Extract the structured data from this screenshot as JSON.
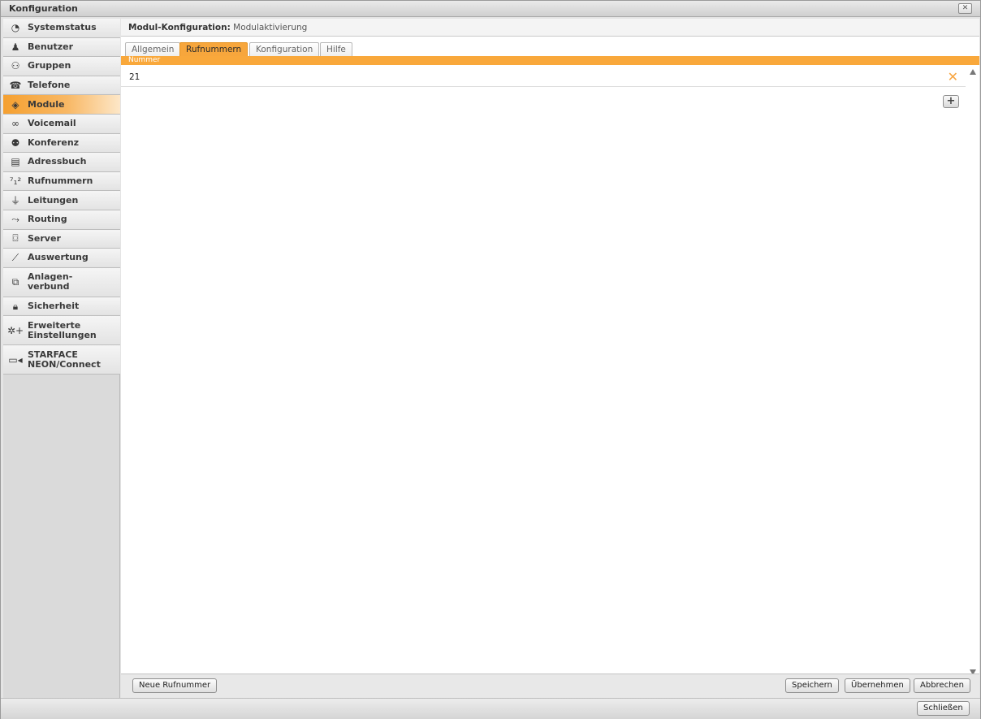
{
  "window": {
    "title": "Konfiguration",
    "close_icon": "close-icon"
  },
  "sidebar": {
    "items": [
      {
        "label": "Systemstatus",
        "icon": "clock-icon"
      },
      {
        "label": "Benutzer",
        "icon": "user-icon"
      },
      {
        "label": "Gruppen",
        "icon": "group-icon"
      },
      {
        "label": "Telefone",
        "icon": "phone-icon"
      },
      {
        "label": "Module",
        "icon": "module-icon",
        "active": true
      },
      {
        "label": "Voicemail",
        "icon": "voicemail-icon"
      },
      {
        "label": "Konferenz",
        "icon": "conference-icon"
      },
      {
        "label": "Adressbuch",
        "icon": "addressbook-icon"
      },
      {
        "label": "Rufnummern",
        "icon": "numbers-icon"
      },
      {
        "label": "Leitungen",
        "icon": "plug-icon"
      },
      {
        "label": "Routing",
        "icon": "routing-icon"
      },
      {
        "label": "Server",
        "icon": "server-icon"
      },
      {
        "label": "Auswertung",
        "icon": "chart-icon"
      },
      {
        "label": "Anlagen-",
        "label2": "verbund",
        "icon": "network-icon"
      },
      {
        "label": "Sicherheit",
        "icon": "lock-icon"
      },
      {
        "label": "Erweiterte",
        "label2": "Einstellungen",
        "icon": "advanced-settings-icon"
      },
      {
        "label": "STARFACE",
        "label2": "NEON/Connect",
        "icon": "video-icon"
      }
    ]
  },
  "header": {
    "title": "Modul-Konfiguration:",
    "subtitle": "Modulaktivierung"
  },
  "tabs": [
    {
      "label": "Allgemein"
    },
    {
      "label": "Rufnummern",
      "active": true
    },
    {
      "label": "Konfiguration"
    },
    {
      "label": "Hilfe"
    }
  ],
  "table": {
    "column_header": "Nummer",
    "rows": [
      {
        "number": "21"
      }
    ]
  },
  "buttons": {
    "new_number": "Neue Rufnummer",
    "save": "Speichern",
    "apply": "Übernehmen",
    "cancel": "Abbrechen",
    "close": "Schließen"
  },
  "colors": {
    "accent": "#f9a83b"
  }
}
